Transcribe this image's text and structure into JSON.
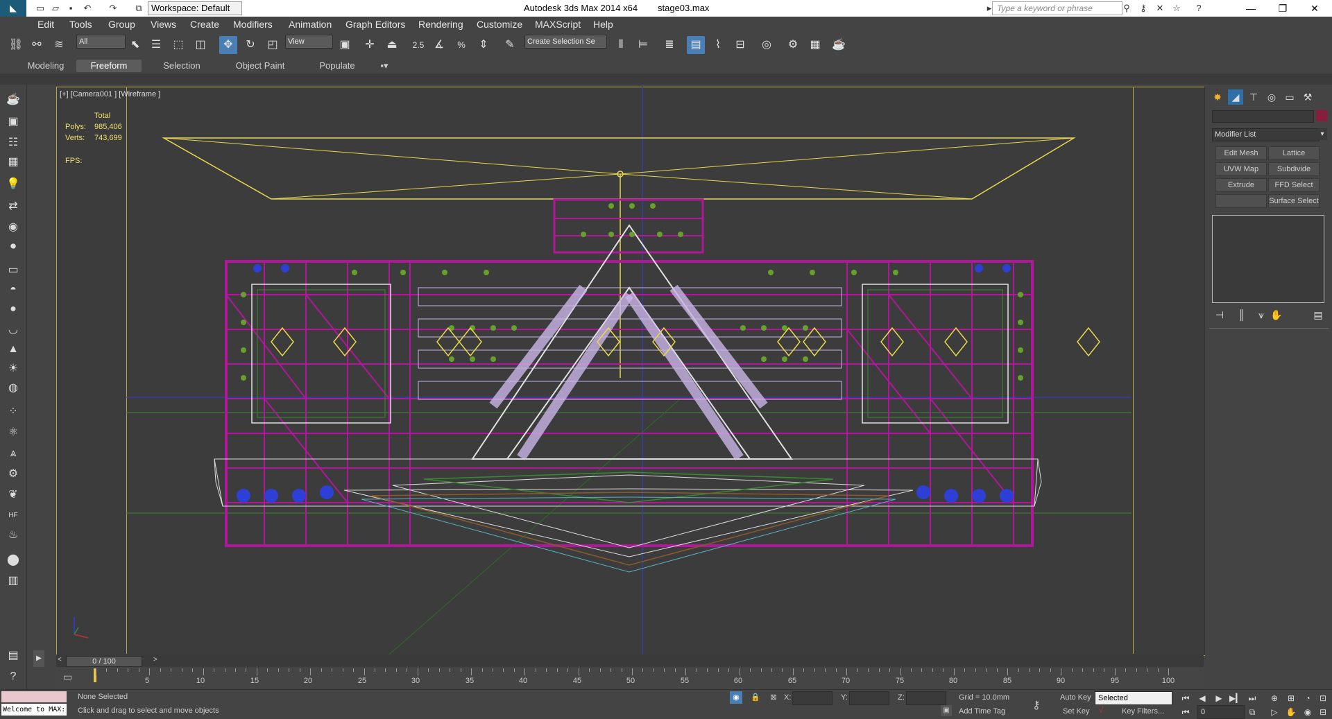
{
  "titlebar": {
    "app_title": "Autodesk 3ds Max  2014 x64",
    "file_name": "stage03.max",
    "workspace": "Workspace: Default",
    "search_placeholder": "Type a keyword or phrase"
  },
  "menu": [
    "Edit",
    "Tools",
    "Group",
    "Views",
    "Create",
    "Modifiers",
    "Animation",
    "Graph Editors",
    "Rendering",
    "Customize",
    "MAXScript",
    "Help"
  ],
  "toolbar": {
    "selection_filter": "All",
    "ref_coord": "View",
    "snap_value": "2.5",
    "named_selection": "Create Selection Se"
  },
  "ribbon": {
    "tabs": [
      "Modeling",
      "Freeform",
      "Selection",
      "Object Paint",
      "Populate"
    ],
    "active_tab": "Freeform"
  },
  "viewport": {
    "label": "[+] [Camera001 ] [Wireframe ]",
    "stats_total": "Total",
    "polys_label": "Polys:",
    "polys_value": "985,406",
    "verts_label": "Verts:",
    "verts_value": "743,699",
    "fps_label": "FPS:"
  },
  "command_panel": {
    "modifier_list": "Modifier List",
    "buttons": [
      "Edit Mesh",
      "Lattice",
      "UVW Map",
      "Subdivide",
      "Extrude",
      "FFD Select",
      "",
      "Surface Select"
    ]
  },
  "time_slider": {
    "frame_display": "0 / 100",
    "ticks": [
      "5",
      "10",
      "15",
      "20",
      "25",
      "30",
      "35",
      "40",
      "45",
      "50",
      "55",
      "60",
      "65",
      "70",
      "75",
      "80",
      "85",
      "90",
      "95",
      "100"
    ]
  },
  "status": {
    "maxscript_prompt": "Welcome to MAX:",
    "selection": "None Selected",
    "prompt": "Click and drag to select and move objects",
    "x_label": "X:",
    "y_label": "Y:",
    "z_label": "Z:",
    "grid": "Grid = 10.0mm",
    "add_time_tag": "Add Time Tag",
    "auto_key": "Auto Key",
    "set_key": "Set Key",
    "key_mode": "Selected",
    "key_filters": "Key Filters...",
    "frame": "0"
  },
  "colors": {
    "wire_magenta": "#b0179a",
    "wire_yellow": "#e8d84a",
    "wire_blue": "#2e3fd6",
    "wire_green": "#66a12b",
    "wire_lilac": "#c9b4e6"
  }
}
